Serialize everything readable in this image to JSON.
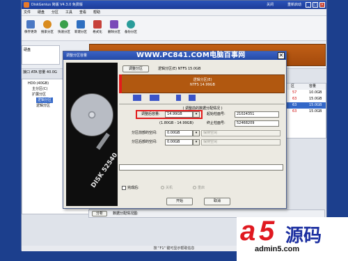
{
  "app": {
    "title": "DiskGenius 简版 V4.3.0 免费版",
    "right_items": [
      "关闭",
      "重新启动"
    ],
    "menus": [
      "文件",
      "硬盘",
      "分区",
      "工具",
      "查看",
      "帮助"
    ],
    "toolbar": [
      {
        "label": "保存更改",
        "color": "#4a78c4"
      },
      {
        "label": "搜索分区",
        "color": "#d98b1e"
      },
      {
        "label": "快速分区",
        "color": "#3aa04c"
      },
      {
        "label": "新建分区",
        "color": "#2f6fc0"
      },
      {
        "label": "格式化",
        "color": "#c7413a"
      },
      {
        "label": "删除分区",
        "color": "#7a49b8"
      },
      {
        "label": "备份分区",
        "color": "#2a9c9a"
      }
    ],
    "disk_label": "硬盘",
    "interface_text": "接口 ATA  容量 40.0G",
    "tree": [
      {
        "label": "HD0:(40GB)",
        "indent": 0,
        "selected": false
      },
      {
        "label": "主分区(C)",
        "indent": 1,
        "selected": false
      },
      {
        "label": "扩展分区",
        "indent": 1,
        "selected": false
      },
      {
        "label": "逻辑分区",
        "indent": 2,
        "selected": true
      },
      {
        "label": "逻辑分区",
        "indent": 2,
        "selected": false
      }
    ],
    "part_table": {
      "headers": [
        "区",
        "容量"
      ],
      "rows": [
        {
          "col1": "57",
          "col2": "10.0GB",
          "selected": false
        },
        {
          "col1": "63",
          "col2": "15.0GB",
          "selected": false
        },
        {
          "col1": "63",
          "col2": "15.0GB",
          "selected": true
        },
        {
          "col1": "63",
          "col2": "15.0GB",
          "selected": false
        }
      ]
    },
    "detail_tab": "分析",
    "detail_text": "数据分配情况图:",
    "status": "按 \"F1\" 键可显示帮助信息"
  },
  "dialog": {
    "title": "调整分区容量",
    "banner": "WWW.PC841.COM电脑百事网",
    "close": "✕",
    "adjust_button": "调整分区",
    "adjust_caption": "逻辑分区(E) NTFS 15.0GB",
    "partition_name": "逻辑分区(E)",
    "partition_info": "NTFS 14.99GB",
    "layout_label": "( 调整前的数据分配情况 )",
    "size_label": "调整后容量:",
    "size_value": "14.99GB",
    "range_text": "(1.80GB - 14.99GB)",
    "start_sector_label": "起始柱面号:",
    "start_sector_value": "21024351",
    "end_sector_label": "终止柱面号:",
    "end_sector_value": "52468209",
    "front_label": "分区前部的空间:",
    "front_value": "0.00GB",
    "front_combo": "保持空闲",
    "back_label": "分区后部的空间:",
    "back_value": "0.00GB",
    "back_combo": "保持空闲",
    "after_label": "完成后:",
    "radio_shutdown": "关机",
    "radio_reboot": "重启",
    "start_button": "开始",
    "cancel_button": "取消",
    "disk_image_label": "DISK 52540"
  },
  "watermark": {
    "letter_a": "a",
    "digit": "5",
    "cn": "源码",
    "url": "admin5.com"
  }
}
